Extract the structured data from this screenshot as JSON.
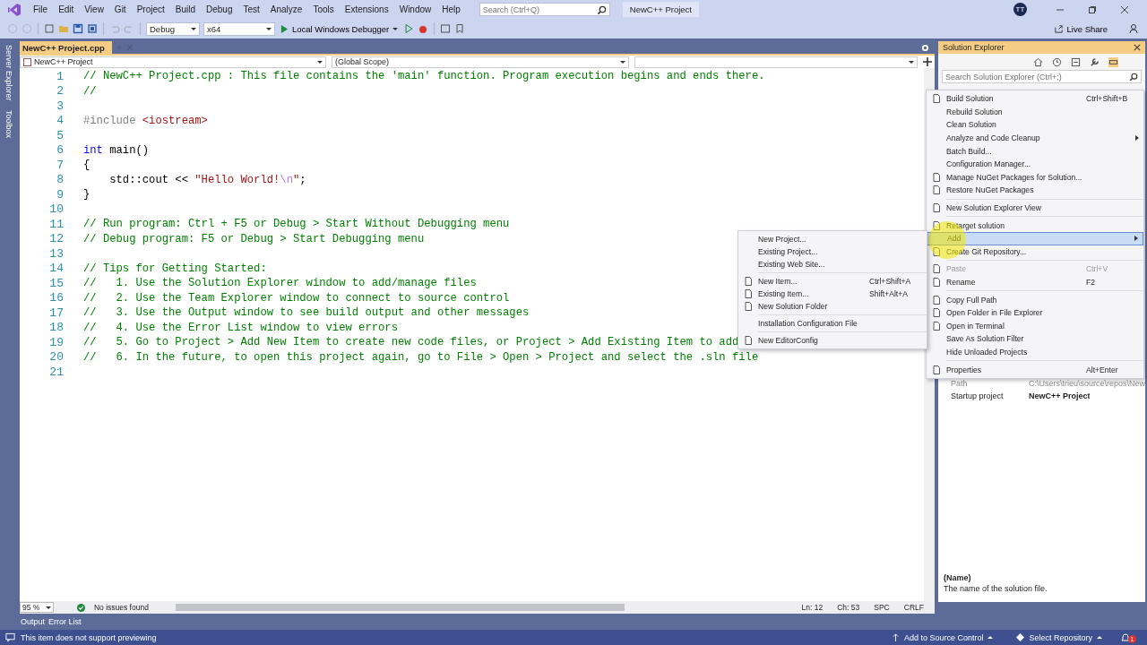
{
  "title_bar": {
    "menu": [
      "File",
      "Edit",
      "View",
      "Git",
      "Project",
      "Build",
      "Debug",
      "Test",
      "Analyze",
      "Tools",
      "Extensions",
      "Window",
      "Help"
    ],
    "search": {
      "placeholder": "Search (Ctrl+Q)"
    },
    "title": "NewC++ Project",
    "avatar": "TT"
  },
  "toolbar": {
    "configuration": "Debug",
    "platform": "x64",
    "debugger": "Local Windows Debugger",
    "live_share": "Live Share"
  },
  "side_tabs": [
    "Server Explorer",
    "Toolbox"
  ],
  "editor": {
    "tab": {
      "label": "NewC++ Project.cpp",
      "selected": true
    },
    "nav": {
      "project": "NewC++ Project",
      "scope": "(Global Scope)"
    },
    "lines": [
      {
        "number": "1",
        "segments": [
          {
            "kind": "comment",
            "text": "// NewC++ Project.cpp : This file contains the 'main' function. Program execution begins and ends there."
          }
        ]
      },
      {
        "number": "2",
        "segments": [
          {
            "kind": "comment",
            "text": "//"
          }
        ]
      },
      {
        "number": "3"
      },
      {
        "number": "4",
        "segments": [
          {
            "kind": "preproc",
            "text": "#include"
          },
          {
            "kind": "string",
            "text": " <iostream>"
          }
        ]
      },
      {
        "number": "5"
      },
      {
        "number": "6",
        "segments": [
          {
            "kind": "keyword",
            "text": "int"
          },
          {
            "kind": "text",
            "text": " main()"
          }
        ]
      },
      {
        "number": "7",
        "segments": [
          {
            "kind": "text",
            "text": "{"
          }
        ]
      },
      {
        "number": "8",
        "segments": [
          {
            "kind": "text",
            "text": "    std::cout << "
          },
          {
            "kind": "string",
            "text": "\"Hello World!"
          },
          {
            "kind": "escape",
            "text": "\\n"
          },
          {
            "kind": "string",
            "text": "\""
          },
          {
            "kind": "text",
            "text": ";"
          }
        ]
      },
      {
        "number": "9",
        "segments": [
          {
            "kind": "text",
            "text": "}"
          }
        ]
      },
      {
        "number": "10"
      },
      {
        "number": "11",
        "segments": [
          {
            "kind": "comment",
            "text": "// Run program: Ctrl + F5 or Debug > Start Without Debugging menu"
          }
        ]
      },
      {
        "number": "12",
        "segments": [
          {
            "kind": "comment",
            "text": "// Debug program: F5 or Debug > Start Debugging menu"
          }
        ]
      },
      {
        "number": "13"
      },
      {
        "number": "14",
        "segments": [
          {
            "kind": "comment",
            "text": "// Tips for Getting Started:"
          }
        ]
      },
      {
        "number": "15",
        "segments": [
          {
            "kind": "comment",
            "text": "//   1. Use the Solution Explorer window to add/manage files"
          }
        ]
      },
      {
        "number": "16",
        "segments": [
          {
            "kind": "comment",
            "text": "//   2. Use the Team Explorer window to connect to source control"
          }
        ]
      },
      {
        "number": "17",
        "segments": [
          {
            "kind": "comment",
            "text": "//   3. Use the Output window to see build output and other messages"
          }
        ]
      },
      {
        "number": "18",
        "segments": [
          {
            "kind": "comment",
            "text": "//   4. Use the Error List window to view errors"
          }
        ]
      },
      {
        "number": "19",
        "segments": [
          {
            "kind": "comment",
            "text": "//   5. Go to Project > Add New Item to create new code files, or Project > Add Existing Item to add"
          }
        ]
      },
      {
        "number": "20",
        "segments": [
          {
            "kind": "comment",
            "text": "//   6. In the future, to open this project again, go to File > Open > Project and select the .sln file"
          }
        ]
      },
      {
        "number": "21"
      }
    ],
    "status": {
      "zoom": "95 %",
      "issues": "No issues found",
      "line": "Ln: 12",
      "column": "Ch: 53",
      "spacing": "SPC",
      "line_ending": "CRLF"
    }
  },
  "bottom_tabs": [
    "Output",
    "Error List"
  ],
  "solution_explorer": {
    "title": "Solution Explorer",
    "search": {
      "placeholder": "Search Solution Explorer (Ctrl+;)"
    },
    "properties": [
      {
        "name": "Path",
        "value": "C:\\Users\\trieu\\source\\repos\\New",
        "disabled": true,
        "bold": false
      },
      {
        "name": "Startup project",
        "value": "NewC++ Project",
        "disabled": false,
        "bold": true
      }
    ],
    "help": {
      "name": "(Name)",
      "description": "The name of the solution file."
    }
  },
  "context_menu": {
    "items": [
      {
        "kind": "item",
        "label": "Build Solution",
        "shortcut": "Ctrl+Shift+B",
        "icon": true,
        "submenu": false,
        "disabled": false,
        "selected": false
      },
      {
        "kind": "item",
        "label": "Rebuild Solution",
        "icon": false,
        "submenu": false,
        "disabled": false,
        "selected": false
      },
      {
        "kind": "item",
        "label": "Clean Solution",
        "icon": false,
        "submenu": false,
        "disabled": false,
        "selected": false
      },
      {
        "kind": "item",
        "label": "Analyze and Code Cleanup",
        "icon": false,
        "submenu": true,
        "disabled": false,
        "selected": false
      },
      {
        "kind": "item",
        "label": "Batch Build...",
        "icon": false,
        "submenu": false,
        "disabled": false,
        "selected": false
      },
      {
        "kind": "item",
        "label": "Configuration Manager...",
        "icon": false,
        "submenu": false,
        "disabled": false,
        "selected": false
      },
      {
        "kind": "item",
        "label": "Manage NuGet Packages for Solution...",
        "icon": true,
        "submenu": false,
        "disabled": false,
        "selected": false
      },
      {
        "kind": "item",
        "label": "Restore NuGet Packages",
        "icon": true,
        "submenu": false,
        "disabled": false,
        "selected": false
      },
      {
        "kind": "separator"
      },
      {
        "kind": "item",
        "label": "New Solution Explorer View",
        "icon": true,
        "submenu": false,
        "disabled": false,
        "selected": false
      },
      {
        "kind": "separator"
      },
      {
        "kind": "item",
        "label": "Retarget solution",
        "icon": true,
        "submenu": false,
        "disabled": false,
        "selected": false
      },
      {
        "kind": "item",
        "label": "Add",
        "icon": false,
        "submenu": true,
        "disabled": false,
        "selected": true
      },
      {
        "kind": "item",
        "label": "Create Git Repository...",
        "icon": true,
        "submenu": false,
        "disabled": false,
        "selected": false
      },
      {
        "kind": "separator"
      },
      {
        "kind": "item",
        "label": "Paste",
        "shortcut": "Ctrl+V",
        "icon": true,
        "submenu": false,
        "disabled": true,
        "selected": false
      },
      {
        "kind": "item",
        "label": "Rename",
        "shortcut": "F2",
        "icon": true,
        "submenu": false,
        "disabled": false,
        "selected": false
      },
      {
        "kind": "separator"
      },
      {
        "kind": "item",
        "label": "Copy Full Path",
        "icon": true,
        "submenu": false,
        "disabled": false,
        "selected": false
      },
      {
        "kind": "item",
        "label": "Open Folder in File Explorer",
        "icon": true,
        "submenu": false,
        "disabled": false,
        "selected": false
      },
      {
        "kind": "item",
        "label": "Open in Terminal",
        "icon": true,
        "submenu": false,
        "disabled": false,
        "selected": false
      },
      {
        "kind": "item",
        "label": "Save As Solution Filter",
        "icon": false,
        "submenu": false,
        "disabled": false,
        "selected": false
      },
      {
        "kind": "item",
        "label": "Hide Unloaded Projects",
        "icon": false,
        "submenu": false,
        "disabled": false,
        "selected": false
      },
      {
        "kind": "separator"
      },
      {
        "kind": "item",
        "label": "Properties",
        "shortcut": "Alt+Enter",
        "icon": true,
        "submenu": false,
        "disabled": false,
        "selected": false
      }
    ]
  },
  "submenu": {
    "items": [
      {
        "kind": "item",
        "label": "New Project...",
        "icon": false,
        "submenu": false,
        "disabled": false,
        "selected": false
      },
      {
        "kind": "item",
        "label": "Existing Project...",
        "icon": false,
        "submenu": false,
        "disabled": false,
        "selected": false
      },
      {
        "kind": "item",
        "label": "Existing Web Site...",
        "icon": false,
        "submenu": false,
        "disabled": false,
        "selected": false
      },
      {
        "kind": "separator"
      },
      {
        "kind": "item",
        "label": "New Item...",
        "shortcut": "Ctrl+Shift+A",
        "icon": true,
        "submenu": false,
        "disabled": false,
        "selected": false
      },
      {
        "kind": "item",
        "label": "Existing Item...",
        "shortcut": "Shift+Alt+A",
        "icon": true,
        "submenu": false,
        "disabled": false,
        "selected": false
      },
      {
        "kind": "item",
        "label": "New Solution Folder",
        "icon": true,
        "submenu": false,
        "disabled": false,
        "selected": false
      },
      {
        "kind": "separator"
      },
      {
        "kind": "item",
        "label": "Installation Configuration File",
        "icon": false,
        "submenu": false,
        "disabled": false,
        "selected": false
      },
      {
        "kind": "separator"
      },
      {
        "kind": "item",
        "label": "New EditorConfig",
        "icon": true,
        "submenu": false,
        "disabled": false,
        "selected": false
      }
    ]
  },
  "status_bar": {
    "message": "This item does not support previewing",
    "source_control": "Add to Source Control",
    "repository": "Select Repository",
    "notifications": "1"
  }
}
